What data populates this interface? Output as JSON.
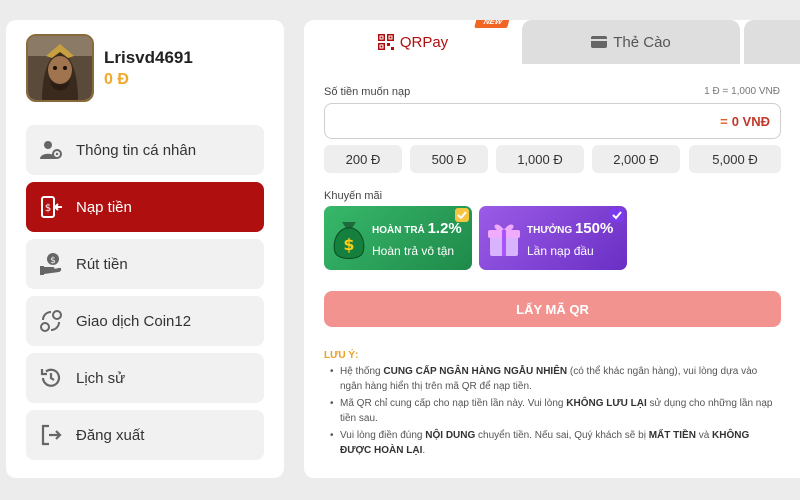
{
  "profile": {
    "username": "Lrisvd4691",
    "balance": "0 Đ"
  },
  "menu": [
    {
      "label": "Thông tin cá nhân",
      "icon": "user-gear-icon"
    },
    {
      "label": "Nạp tiền",
      "icon": "deposit-phone-icon",
      "active": true
    },
    {
      "label": "Rút tiền",
      "icon": "withdraw-hand-icon"
    },
    {
      "label": "Giao dịch Coin12",
      "icon": "exchange-icon"
    },
    {
      "label": "Lịch sử",
      "icon": "history-icon"
    },
    {
      "label": "Đăng xuất",
      "icon": "logout-icon"
    }
  ],
  "tabs": {
    "qr_label": "QRPay",
    "card_label": "Thẻ Cào",
    "new_badge": "NEW"
  },
  "amount": {
    "label": "Số tiền muốn nạp",
    "rate": "1 Đ = 1,000 VNĐ",
    "eq": "=",
    "value": "0 VNĐ"
  },
  "chips": [
    "200 Đ",
    "500 Đ",
    "1,000 Đ",
    "2,000 Đ",
    "5,000 Đ"
  ],
  "promotions": {
    "label": "Khuyến mãi",
    "refund": {
      "title": "HOÀN TRẢ",
      "percent": "1.2%",
      "subtitle": "Hoàn trả vô tận"
    },
    "bonus": {
      "title": "THƯỞNG",
      "percent": "150%",
      "subtitle": "Lần nạp đầu"
    }
  },
  "button": {
    "label": "LẤY MÃ QR"
  },
  "notes": {
    "title": "LƯU Ý:",
    "n1a": "Hệ thống ",
    "n1b": "CUNG CẤP NGÂN HÀNG NGẪU NHIÊN",
    "n1c": " (có thể khác ngân hàng), vui lòng dựa vào ngân hàng hiển thị trên mã QR để nạp tiền.",
    "n2a": "Mã QR chỉ cung cấp cho nạp tiền lần này. Vui lòng ",
    "n2b": "KHÔNG LƯU LẠI",
    "n2c": " sử dụng cho những lần nạp tiền sau.",
    "n3a": "Vui lòng điền đúng ",
    "n3b": "NỘI DUNG",
    "n3c": " chuyển tiền. Nếu sai, Quý khách sẽ bị ",
    "n3d": "MẤT TIỀN",
    "n3e": " và ",
    "n3f": "KHÔNG ĐƯỢC HOÀN LẠI",
    "n3g": "."
  },
  "colors": {
    "active_menu": "#b00f0f",
    "balance": "#f0a92a",
    "qr_button": "#f2938f",
    "note_title": "#e8a020"
  }
}
